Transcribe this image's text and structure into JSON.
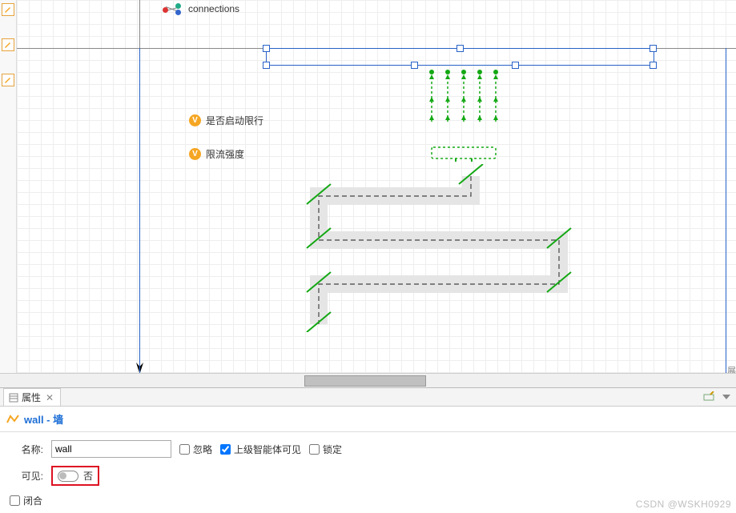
{
  "canvas": {
    "connections_label": "connections",
    "var1": "是否启动限行",
    "var2": "限流强度",
    "v_badge": "V"
  },
  "tabs": {
    "properties_label": "属性",
    "close_glyph": "✕"
  },
  "title": {
    "text": "wall - 墙"
  },
  "form": {
    "name_label": "名称:",
    "name_value": "wall",
    "ignore_label": "忽略",
    "parent_visible_label": "上级智能体可见",
    "lock_label": "锁定",
    "visible_label": "可见:",
    "visible_value": "否",
    "closed_label": "闭合"
  },
  "states": {
    "ignore_checked": false,
    "parent_visible_checked": true,
    "lock_checked": false,
    "closed_checked": false
  },
  "watermark": "CSDN @WSKH0929",
  "right_edge_hint": "展"
}
